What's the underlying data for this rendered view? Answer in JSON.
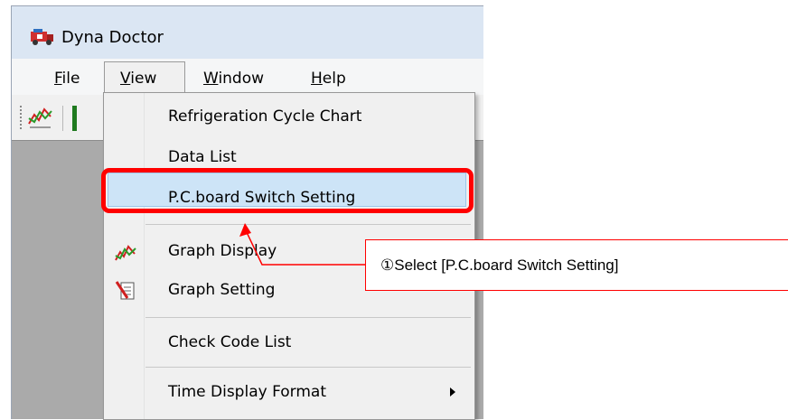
{
  "window": {
    "title": "Dyna Doctor"
  },
  "menubar": {
    "items": [
      {
        "prefix": "",
        "underlined": "F",
        "rest": "ile"
      },
      {
        "prefix": "",
        "underlined": "V",
        "rest": "iew"
      },
      {
        "prefix": "",
        "underlined": "W",
        "rest": "indow"
      },
      {
        "prefix": "",
        "underlined": "H",
        "rest": "elp"
      }
    ]
  },
  "view_menu": {
    "items": [
      "Refrigeration Cycle Chart",
      "Data List",
      "P.C.board Switch Setting",
      "Graph Display",
      "Graph Setting",
      "Check Code List",
      "Time Display Format"
    ],
    "highlighted": "P.C.board Switch Setting"
  },
  "annotation": {
    "callout_text": "①Select [P.C.board Switch Setting]",
    "highlight_color": "#ff0000"
  },
  "icons": {
    "app": "dyna-doctor-app-icon",
    "toolbar": [
      "graph-display-icon",
      "green-bar-icon"
    ],
    "menu": [
      "graph-display-icon",
      "graph-setting-icon"
    ]
  }
}
